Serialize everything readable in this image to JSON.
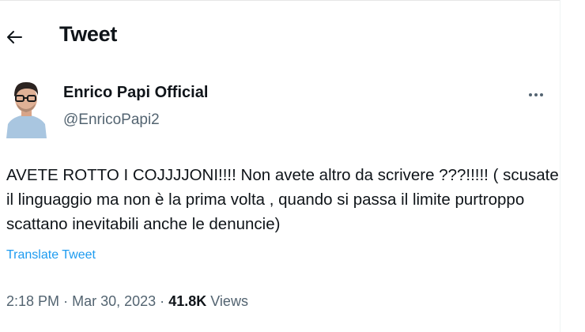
{
  "header": {
    "title": "Tweet"
  },
  "author": {
    "name": "Enrico Papi Official",
    "handle": "@EnricoPapi2"
  },
  "tweet": {
    "lines": [
      "AVETE ROTTO I COJJJJONI!!!! Non avete altro da scrivere ???!!!!! ( scusate",
      "il linguaggio ma non è la prima volta , quando si passa il limite purtroppo",
      "scattano inevitabili anche le denuncie)"
    ],
    "translate_label": "Translate Tweet"
  },
  "meta": {
    "time": "2:18 PM",
    "sep1": "·",
    "date": "Mar 30, 2023",
    "sep2": "·",
    "views_count": "41.8K",
    "views_label": "Views"
  },
  "icons": {
    "back": "arrow-left-icon",
    "more": "more-horizontal-icon"
  },
  "colors": {
    "link": "#1d9bf0",
    "secondary_text": "#536471",
    "primary_text": "#0f1419"
  }
}
